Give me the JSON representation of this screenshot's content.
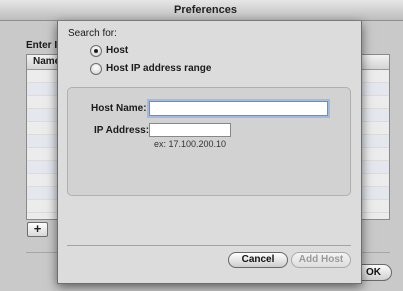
{
  "prefs_window": {
    "title": "Preferences",
    "enter_label": "Enter I",
    "table_column_name": "Name",
    "add_button": "+",
    "ok_button": "OK"
  },
  "sheet": {
    "search_for_label": "Search for:",
    "radio_options": [
      {
        "label": "Host",
        "checked": true
      },
      {
        "label": "Host IP address range",
        "checked": false
      }
    ],
    "host_name_label": "Host Name:",
    "host_name_value": "",
    "ip_address_label": "IP Address:",
    "ip_address_value": "",
    "ip_example": "ex: 17.100.200.10",
    "cancel_button": "Cancel",
    "add_host_button": "Add Host"
  },
  "colors": {
    "focus_ring": "#9ebbe3",
    "sheet_background": "#dcdcdc",
    "disabled_text": "#9a9a9a"
  }
}
